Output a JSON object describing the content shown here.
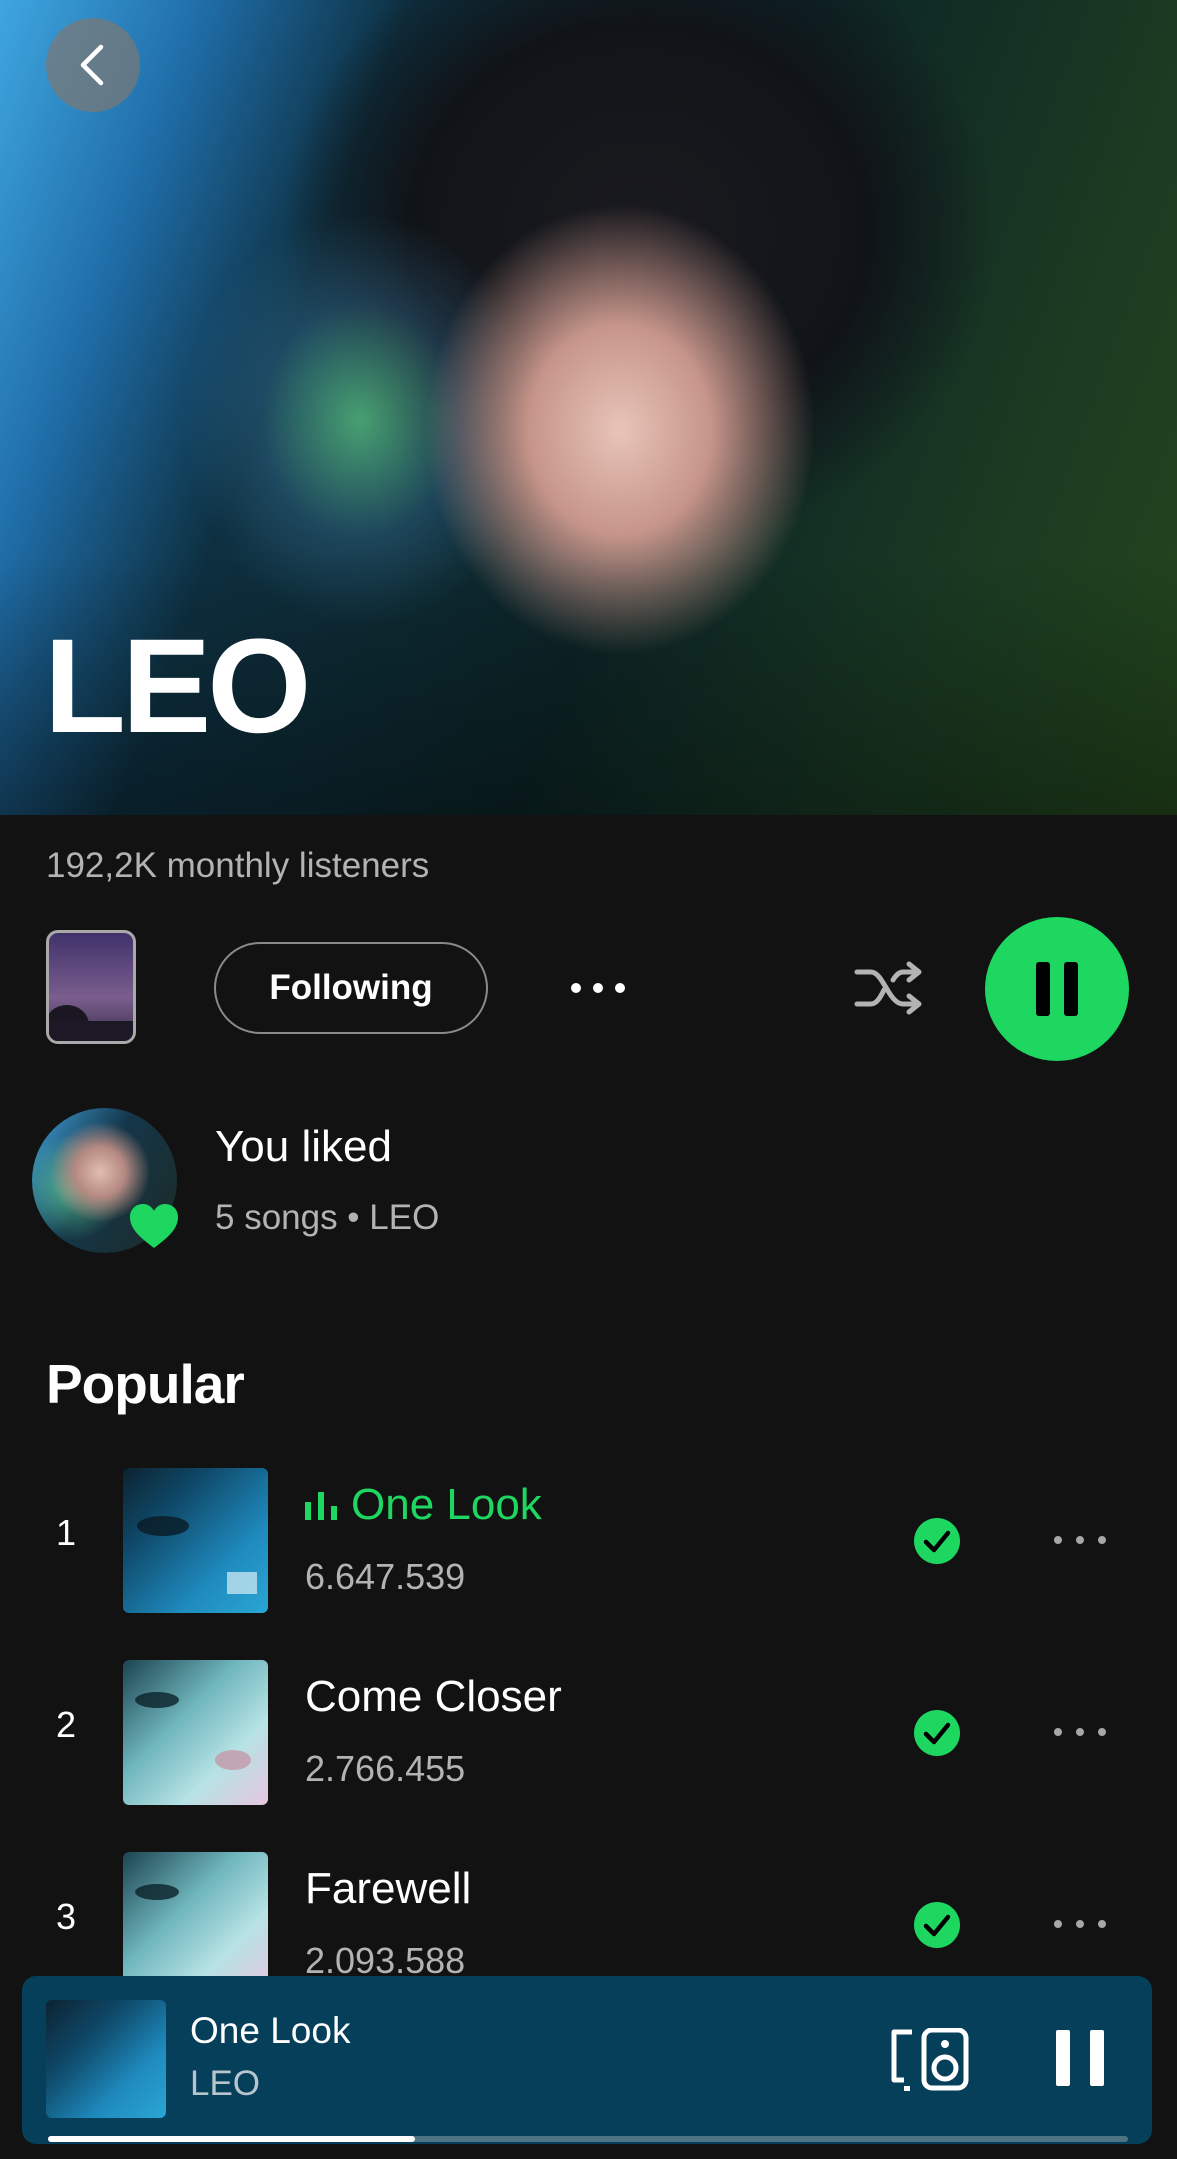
{
  "artist": {
    "name": "LEO",
    "monthly_listeners": "192,2K monthly listeners"
  },
  "actions": {
    "follow_label": "Following"
  },
  "liked": {
    "title": "You liked",
    "subtitle": "5 songs • LEO"
  },
  "popular": {
    "heading": "Popular",
    "tracks": [
      {
        "rank": "1",
        "title": "One Look",
        "plays": "6.647.539",
        "now_playing": true
      },
      {
        "rank": "2",
        "title": "Come Closer",
        "plays": "2.766.455",
        "now_playing": false
      },
      {
        "rank": "3",
        "title": "Farewell",
        "plays": "2.093.588",
        "now_playing": false
      }
    ]
  },
  "mini_player": {
    "title": "One Look",
    "artist": "LEO",
    "progress": 0.34
  },
  "colors": {
    "accent": "#1ed760",
    "background": "#121212",
    "mini_player_bg": "#063f5a"
  },
  "icons": {
    "back": "chevron-left-icon",
    "more": "more-horizontal-icon",
    "shuffle": "shuffle-icon",
    "play_pause": "pause-icon",
    "liked": "heart-icon",
    "downloaded": "check-circle-icon",
    "device": "speaker-device-icon",
    "equalizer": "equalizer-bars-icon"
  }
}
